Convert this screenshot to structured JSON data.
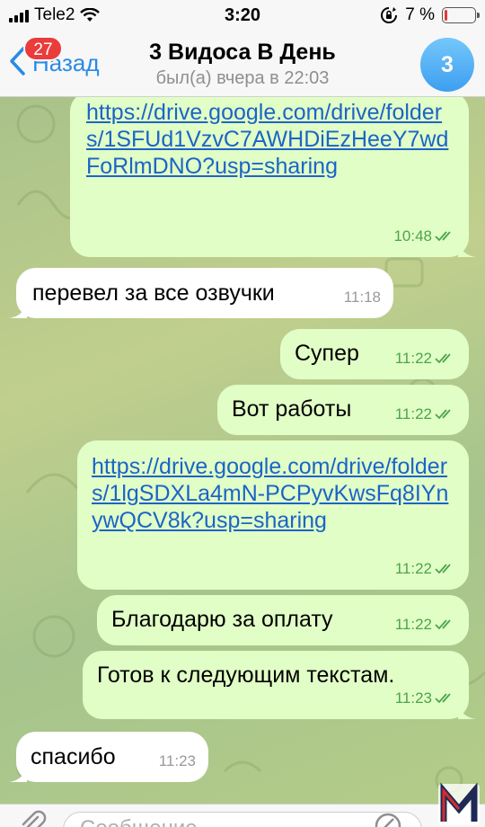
{
  "status": {
    "carrier": "Tele2",
    "time": "3:20",
    "battery_percent": "7 %",
    "battery_level": 0.07
  },
  "nav": {
    "back_label": "Назад",
    "unread_count": "27",
    "title": "3 Видоса В День",
    "subtitle": "был(а) вчера в 22:03",
    "avatar_initial": "3"
  },
  "messages": [
    {
      "dir": "out",
      "text": "https://drive.google.com/drive/folders/1SFUd1VzvC7AWHDiEzHeeY7wdFoRlmDNO?usp=sharing",
      "time": "10:48"
    },
    {
      "dir": "in",
      "text": "перевел за все озвучки",
      "time": "11:18"
    },
    {
      "dir": "out",
      "text": "Супер",
      "time": "11:22"
    },
    {
      "dir": "out",
      "text": "Вот работы",
      "time": "11:22"
    },
    {
      "dir": "out",
      "text": "https://drive.google.com/drive/folders/1lgSDXLa4mN-PCPyvKwsFq8IYnywQCV8k?usp=sharing",
      "time": "11:22"
    },
    {
      "dir": "out",
      "text": "Благодарю за оплату",
      "time": "11:22"
    },
    {
      "dir": "out",
      "text": "Готов к следующим текстам.",
      "time": "11:23"
    },
    {
      "dir": "in",
      "text": "спасибо",
      "time": "11:23"
    }
  ],
  "input": {
    "placeholder": "Сообщение"
  },
  "colors": {
    "accent": "#2a8ae6",
    "badge": "#ea3c3a",
    "outgoing_bubble": "#e1fec6",
    "incoming_bubble": "#ffffff",
    "link": "#1b64c8",
    "read_ticks": "#4ca44c"
  },
  "icons": [
    "signal-icon",
    "wifi-icon",
    "orientation-lock-icon",
    "battery-icon",
    "chevron-left-icon",
    "double-check-icon",
    "paperclip-icon",
    "sticker-icon"
  ]
}
